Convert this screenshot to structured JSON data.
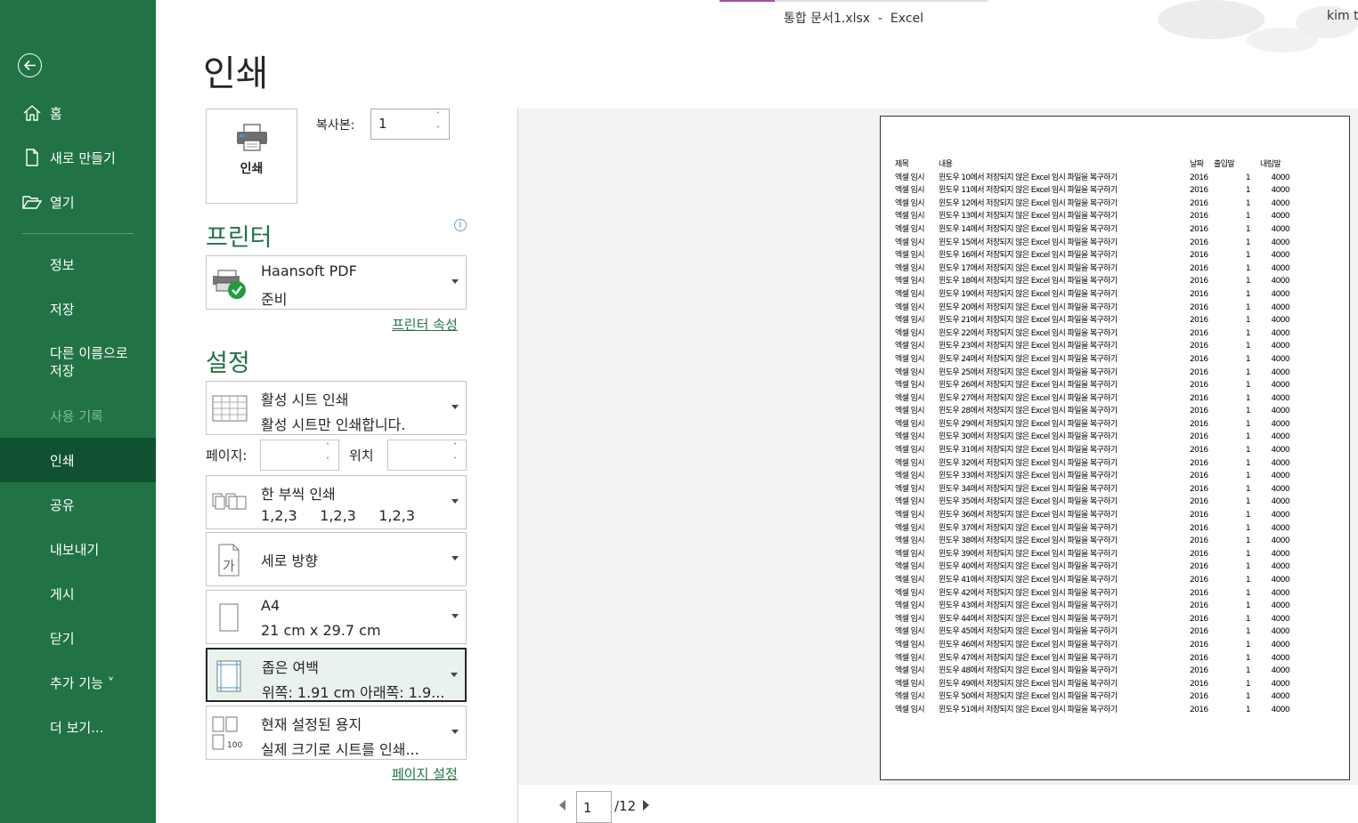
{
  "window": {
    "title": "통합 문서1.xlsx  -  Excel",
    "user": "kim t"
  },
  "sidebar": {
    "home": "홈",
    "new": "새로 만들기",
    "open": "열기",
    "info": "정보",
    "save": "저장",
    "save_as_line1": "다른 이름으로",
    "save_as_line2": "저장",
    "history": "사용 기록",
    "print": "인쇄",
    "share": "공유",
    "export": "내보내기",
    "publish": "게시",
    "close": "닫기",
    "addins": "추가 기능 ˅",
    "more": "더 보기..."
  },
  "print": {
    "title": "인쇄",
    "print_button": "인쇄",
    "copies_label": "복사본:",
    "copies_value": "1"
  },
  "printer": {
    "heading": "프린터",
    "name": "Haansoft PDF",
    "status": "준비",
    "properties_link": "프린터 속성"
  },
  "settings": {
    "heading": "설정",
    "scope_title": "활성 시트 인쇄",
    "scope_desc": "활성 시트만 인쇄합니다.",
    "pages_label": "페이지:",
    "to_label": "위치",
    "collate_title": "한 부씩 인쇄",
    "collate_desc": "1,2,3     1,2,3     1,2,3",
    "orientation": "세로 방향",
    "paper_title": "A4",
    "paper_desc": "21 cm x 29.7 cm",
    "margins_title": "좁은 여백",
    "margins_desc": "위쪽: 1.91 cm 아래쪽: 1.9...",
    "scaling_title": "현재 설정된 용지",
    "scaling_desc": "실제 크기로 시트를 인쇄...",
    "scaling_icon_text": "100",
    "orientation_icon_text": "가",
    "page_setup_link": "페이지 설정"
  },
  "preview": {
    "current_page": "1",
    "total_pages": "/12",
    "headers": [
      "제목",
      "내용",
      "날짜",
      "출입말",
      "내림말"
    ],
    "rows": [
      [
        "엑셀 임시",
        "윈도우 10에서 저장되지 않은 Excel 임시 파일을 복구하기",
        "2016",
        "1",
        "4000"
      ],
      [
        "엑셀 임시",
        "윈도우 11에서 저장되지 않은 Excel 임시 파일을 복구하기",
        "2016",
        "1",
        "4000"
      ],
      [
        "엑셀 임시",
        "윈도우 12에서 저장되지 않은 Excel 임시 파일을 복구하기",
        "2016",
        "1",
        "4000"
      ],
      [
        "엑셀 임시",
        "윈도우 13에서 저장되지 않은 Excel 임시 파일을 복구하기",
        "2016",
        "1",
        "4000"
      ],
      [
        "엑셀 임시",
        "윈도우 14에서 저장되지 않은 Excel 임시 파일을 복구하기",
        "2016",
        "1",
        "4000"
      ],
      [
        "엑셀 임시",
        "윈도우 15에서 저장되지 않은 Excel 임시 파일을 복구하기",
        "2016",
        "1",
        "4000"
      ],
      [
        "엑셀 임시",
        "윈도우 16에서 저장되지 않은 Excel 임시 파일을 복구하기",
        "2016",
        "1",
        "4000"
      ],
      [
        "엑셀 임시",
        "윈도우 17에서 저장되지 않은 Excel 임시 파일을 복구하기",
        "2016",
        "1",
        "4000"
      ],
      [
        "엑셀 임시",
        "윈도우 18에서 저장되지 않은 Excel 임시 파일을 복구하기",
        "2016",
        "1",
        "4000"
      ],
      [
        "엑셀 임시",
        "윈도우 19에서 저장되지 않은 Excel 임시 파일을 복구하기",
        "2016",
        "1",
        "4000"
      ],
      [
        "엑셀 임시",
        "윈도우 20에서 저장되지 않은 Excel 임시 파일을 복구하기",
        "2016",
        "1",
        "4000"
      ],
      [
        "엑셀 임시",
        "윈도우 21에서 저장되지 않은 Excel 임시 파일을 복구하기",
        "2016",
        "1",
        "4000"
      ],
      [
        "엑셀 임시",
        "윈도우 22에서 저장되지 않은 Excel 임시 파일을 복구하기",
        "2016",
        "1",
        "4000"
      ],
      [
        "엑셀 임시",
        "윈도우 23에서 저장되지 않은 Excel 임시 파일을 복구하기",
        "2016",
        "1",
        "4000"
      ],
      [
        "엑셀 임시",
        "윈도우 24에서 저장되지 않은 Excel 임시 파일을 복구하기",
        "2016",
        "1",
        "4000"
      ],
      [
        "엑셀 임시",
        "윈도우 25에서 저장되지 않은 Excel 임시 파일을 복구하기",
        "2016",
        "1",
        "4000"
      ],
      [
        "엑셀 임시",
        "윈도우 26에서 저장되지 않은 Excel 임시 파일을 복구하기",
        "2016",
        "1",
        "4000"
      ],
      [
        "엑셀 임시",
        "윈도우 27에서 저장되지 않은 Excel 임시 파일을 복구하기",
        "2016",
        "1",
        "4000"
      ],
      [
        "엑셀 임시",
        "윈도우 28에서 저장되지 않은 Excel 임시 파일을 복구하기",
        "2016",
        "1",
        "4000"
      ],
      [
        "엑셀 임시",
        "윈도우 29에서 저장되지 않은 Excel 임시 파일을 복구하기",
        "2016",
        "1",
        "4000"
      ],
      [
        "엑셀 임시",
        "윈도우 30에서 저장되지 않은 Excel 임시 파일을 복구하기",
        "2016",
        "1",
        "4000"
      ],
      [
        "엑셀 임시",
        "윈도우 31에서 저장되지 않은 Excel 임시 파일을 복구하기",
        "2016",
        "1",
        "4000"
      ],
      [
        "엑셀 임시",
        "윈도우 32에서 저장되지 않은 Excel 임시 파일을 복구하기",
        "2016",
        "1",
        "4000"
      ],
      [
        "엑셀 임시",
        "윈도우 33에서 저장되지 않은 Excel 임시 파일을 복구하기",
        "2016",
        "1",
        "4000"
      ],
      [
        "엑셀 임시",
        "윈도우 34에서 저장되지 않은 Excel 임시 파일을 복구하기",
        "2016",
        "1",
        "4000"
      ],
      [
        "엑셀 임시",
        "윈도우 35에서 저장되지 않은 Excel 임시 파일을 복구하기",
        "2016",
        "1",
        "4000"
      ],
      [
        "엑셀 임시",
        "윈도우 36에서 저장되지 않은 Excel 임시 파일을 복구하기",
        "2016",
        "1",
        "4000"
      ],
      [
        "엑셀 임시",
        "윈도우 37에서 저장되지 않은 Excel 임시 파일을 복구하기",
        "2016",
        "1",
        "4000"
      ],
      [
        "엑셀 임시",
        "윈도우 38에서 저장되지 않은 Excel 임시 파일을 복구하기",
        "2016",
        "1",
        "4000"
      ],
      [
        "엑셀 임시",
        "윈도우 39에서 저장되지 않은 Excel 임시 파일을 복구하기",
        "2016",
        "1",
        "4000"
      ],
      [
        "엑셀 임시",
        "윈도우 40에서 저장되지 않은 Excel 임시 파일을 복구하기",
        "2016",
        "1",
        "4000"
      ],
      [
        "엑셀 임시",
        "윈도우 41에서 저장되지 않은 Excel 임시 파일을 복구하기",
        "2016",
        "1",
        "4000"
      ],
      [
        "엑셀 임시",
        "윈도우 42에서 저장되지 않은 Excel 임시 파일을 복구하기",
        "2016",
        "1",
        "4000"
      ],
      [
        "엑셀 임시",
        "윈도우 43에서 저장되지 않은 Excel 임시 파일을 복구하기",
        "2016",
        "1",
        "4000"
      ],
      [
        "엑셀 임시",
        "윈도우 44에서 저장되지 않은 Excel 임시 파일을 복구하기",
        "2016",
        "1",
        "4000"
      ],
      [
        "엑셀 임시",
        "윈도우 45에서 저장되지 않은 Excel 임시 파일을 복구하기",
        "2016",
        "1",
        "4000"
      ],
      [
        "엑셀 임시",
        "윈도우 46에서 저장되지 않은 Excel 임시 파일을 복구하기",
        "2016",
        "1",
        "4000"
      ],
      [
        "엑셀 임시",
        "윈도우 47에서 저장되지 않은 Excel 임시 파일을 복구하기",
        "2016",
        "1",
        "4000"
      ],
      [
        "엑셀 임시",
        "윈도우 48에서 저장되지 않은 Excel 임시 파일을 복구하기",
        "2016",
        "1",
        "4000"
      ],
      [
        "엑셀 임시",
        "윈도우 49에서 저장되지 않은 Excel 임시 파일을 복구하기",
        "2016",
        "1",
        "4000"
      ],
      [
        "엑셀 임시",
        "윈도우 50에서 저장되지 않은 Excel 임시 파일을 복구하기",
        "2016",
        "1",
        "4000"
      ],
      [
        "엑셀 임시",
        "윈도우 51에서 저장되지 않은 Excel 임시 파일을 복구하기",
        "2016",
        "1",
        "4000"
      ]
    ]
  },
  "colors": {
    "brand": "#217346",
    "brand_dark": "#0f5130",
    "check": "#1f9d3a"
  },
  "icons": {
    "back": "back-arrow-icon",
    "home": "home-icon",
    "new": "new-document-icon",
    "open": "folder-open-icon",
    "printer": "printer-icon",
    "info": "info-icon",
    "sheet": "sheet-grid-icon",
    "collate": "collate-icon",
    "orientation": "portrait-icon",
    "paper": "paper-size-icon",
    "margins": "margins-icon",
    "scaling": "scaling-icon"
  }
}
